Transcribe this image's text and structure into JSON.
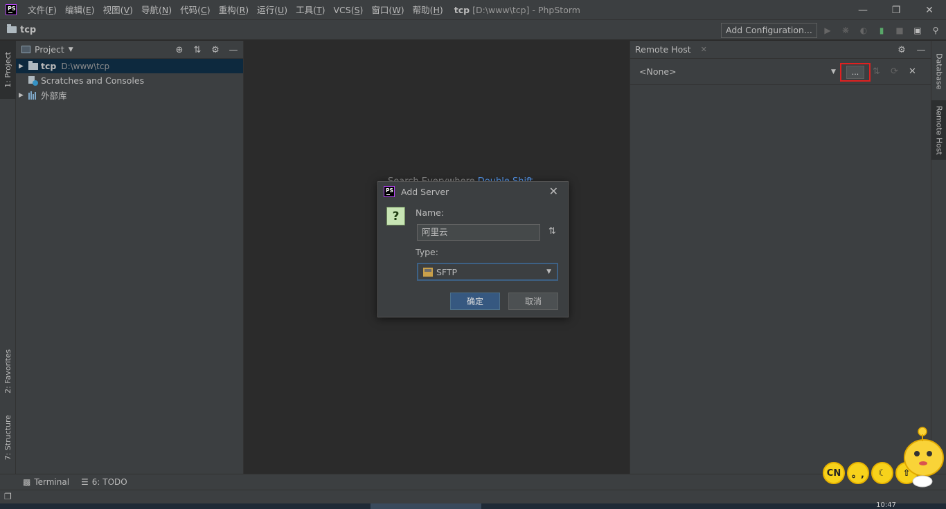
{
  "titlebar": {
    "menu": [
      {
        "label": "文件(",
        "key": "F",
        "tail": ")"
      },
      {
        "label": "编辑(",
        "key": "E",
        "tail": ")"
      },
      {
        "label": "视图(",
        "key": "V",
        "tail": ")"
      },
      {
        "label": "导航(",
        "key": "N",
        "tail": ")"
      },
      {
        "label": "代码(",
        "key": "C",
        "tail": ")"
      },
      {
        "label": "重构(",
        "key": "R",
        "tail": ")"
      },
      {
        "label": "运行(",
        "key": "U",
        "tail": ")"
      },
      {
        "label": "工具(",
        "key": "T",
        "tail": ")"
      },
      {
        "label": "VCS(",
        "key": "S",
        "tail": ")"
      },
      {
        "label": "窗口(",
        "key": "W",
        "tail": ")"
      },
      {
        "label": "帮助(",
        "key": "H",
        "tail": ")"
      }
    ],
    "project_name": "tcp",
    "project_path": "[D:\\www\\tcp]",
    "app_name": " - PhpStorm"
  },
  "navbar": {
    "breadcrumb": "tcp",
    "add_configuration": "Add Configuration..."
  },
  "left_stripe": {
    "project_tab": "1: Project",
    "favorites_tab": "2: Favorites",
    "structure_tab": "7: Structure"
  },
  "project_panel": {
    "title": "Project",
    "tree": [
      {
        "name": "tcp",
        "path": "D:\\www\\tcp"
      },
      {
        "name": "Scratches and Consoles"
      },
      {
        "name": "外部库"
      }
    ]
  },
  "editor": {
    "hint_text": "Search Everywhere ",
    "hint_shortcut": "Double Shift"
  },
  "remote_host": {
    "title": "Remote Host",
    "selected_server": "<None>",
    "browse_label": "..."
  },
  "right_stripe": {
    "database_tab": "Database",
    "remote_host_tab": "Remote Host"
  },
  "bottom_bar": {
    "terminal": "Terminal",
    "todo": "6: TODO"
  },
  "taskbar": {
    "clock": "10:47"
  },
  "dialog": {
    "title": "Add Server",
    "name_label": "Name:",
    "name_value": "阿里云",
    "type_label": "Type:",
    "type_value": "SFTP",
    "ok_label": "确定",
    "cancel_label": "取消"
  },
  "ime": {
    "lang": "CN",
    "punct": "。,"
  },
  "colors": {
    "accent": "#365880",
    "highlight_box": "#e02020",
    "selection": "#0d293e",
    "background": "#3c3f41",
    "editor_bg": "#2b2b2b"
  }
}
